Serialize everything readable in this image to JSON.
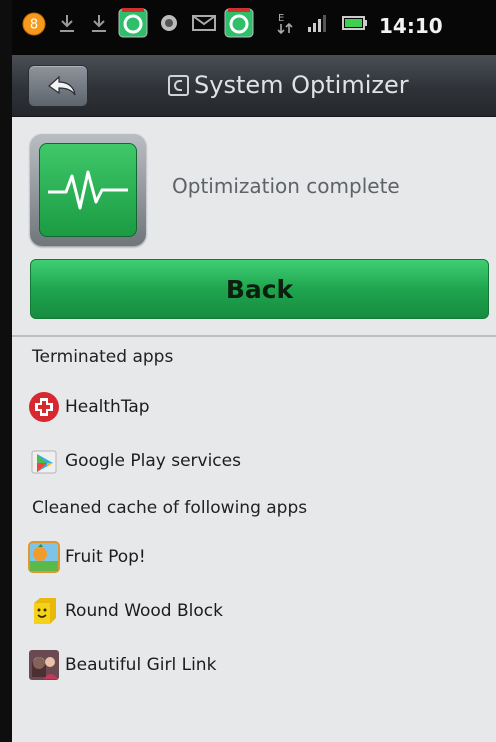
{
  "status_bar": {
    "time": "14:10",
    "badge": "8",
    "signal_label": "E",
    "icons": [
      "notification-badge-icon",
      "download-icon",
      "download-icon",
      "comodo-icon",
      "android-icon",
      "email-icon",
      "comodo-icon",
      "data-arrows-icon",
      "signal-icon",
      "battery-icon"
    ]
  },
  "header": {
    "title": "System Optimizer",
    "back_icon": "back-arrow-icon"
  },
  "result": {
    "message": "Optimization complete",
    "icon": "heartbeat-monitor-icon"
  },
  "actions": {
    "back_label": "Back"
  },
  "terminated": {
    "heading": "Terminated apps",
    "apps": [
      {
        "name": "HealthTap",
        "icon": "healthtap-icon"
      },
      {
        "name": "Google Play services",
        "icon": "google-play-icon"
      }
    ]
  },
  "cleaned": {
    "heading": "Cleaned cache of following apps",
    "apps": [
      {
        "name": "Fruit Pop!",
        "icon": "fruit-pop-icon"
      },
      {
        "name": "Round Wood Block",
        "icon": "wood-block-icon"
      },
      {
        "name": "Beautiful Girl Link",
        "icon": "girl-link-icon"
      }
    ]
  },
  "colors": {
    "accent_green": "#23a94f",
    "header_bg": "#2f3338",
    "content_bg": "#e6e8ea"
  }
}
